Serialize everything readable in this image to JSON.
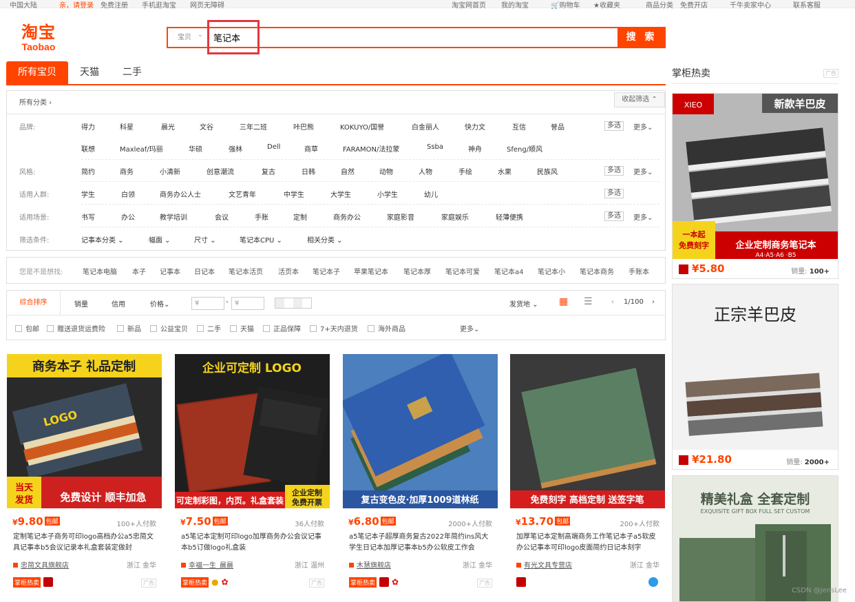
{
  "topbar": {
    "region": "中国大陆",
    "login": "亲，请登录",
    "register": "免费注册",
    "mobile": "手机逛淘宝",
    "access": "网页无障碍",
    "home": "淘宝网首页",
    "my": "我的淘宝",
    "cart": "购物车",
    "fav": "收藏夹",
    "category": "商品分类",
    "shop": "免费开店",
    "seller": "千牛卖家中心",
    "service": "联系客服"
  },
  "logo": {
    "cn": "淘宝",
    "en": "Taobao"
  },
  "search": {
    "scope": "宝贝",
    "value": "笔记本",
    "button": "搜 索"
  },
  "tabs": [
    "所有宝贝",
    "天猫",
    "二手"
  ],
  "filter": {
    "all": "所有分类 ›",
    "collapse": "收起筛选 ⌃",
    "multi": "多选",
    "more": "更多⌄",
    "brand_label": "品牌:",
    "brands1": [
      "得力",
      "科星",
      "晨光",
      "文谷",
      "三年二班",
      "咔巴熊",
      "KOKUYO/国誉",
      "白金丽人",
      "快力文",
      "互信",
      "誉品"
    ],
    "brands2": [
      "联想",
      "Maxleaf/玛丽",
      "华硕",
      "强林",
      "Dell",
      "商草",
      "FARAMON/法拉蒙",
      "Ssba",
      "神舟",
      "Sfeng/顺风"
    ],
    "style_label": "风格:",
    "styles": [
      "简约",
      "商务",
      "小清新",
      "创意潮流",
      "复古",
      "日韩",
      "自然",
      "动物",
      "人物",
      "手绘",
      "水果",
      "民族风"
    ],
    "people_label": "适用人群:",
    "people": [
      "学生",
      "白领",
      "商务办公人士",
      "文艺青年",
      "中学生",
      "大学生",
      "小学生",
      "幼儿"
    ],
    "scene_label": "适用场景:",
    "scenes": [
      "书写",
      "办公",
      "教学培训",
      "会议",
      "手账",
      "定制",
      "商务办公",
      "家庭影音",
      "家庭娱乐",
      "轻薄便携"
    ],
    "cond_label": "筛选条件:",
    "conds": [
      "记事本分类 ⌄",
      "幅面 ⌄",
      "尺寸 ⌄",
      "笔记本CPU ⌄",
      "相关分类 ⌄"
    ]
  },
  "guess": {
    "label": "您是不是想找:",
    "items": [
      "笔记本电脑",
      "本子",
      "记事本",
      "日记本",
      "笔记本活页",
      "活页本",
      "笔记本子",
      "苹果笔记本",
      "笔记本厚",
      "笔记本可爱",
      "笔记本a4",
      "笔记本小",
      "笔记本商务",
      "手账本"
    ]
  },
  "sort": {
    "items": [
      "综合排序",
      "销量",
      "信用",
      "价格⌄"
    ],
    "price_from": "¥",
    "price_to": "¥",
    "ship": "发货地 ⌄",
    "page": "1/100",
    "checks": [
      "包邮",
      "赠送退货运费险",
      "新品",
      "公益宝贝",
      "二手",
      "天猫",
      "正品保障",
      "7+天内退货",
      "海外商品"
    ],
    "more": "更多⌄"
  },
  "products": [
    {
      "price": "9.80",
      "tag": "包邮",
      "count": "100+人付款",
      "title": "定制笔记本子商务可印logo高档办公a5忠简文具记事本b5会议记录本礼盒套装定做封",
      "shop": "忠简文具旗舰店",
      "loc": "浙江 金华",
      "banner1": "商务本子 礼品定制",
      "banner2": "免费设计 顺丰加急"
    },
    {
      "price": "7.50",
      "tag": "包邮",
      "count": "36人付款",
      "title": "a5笔记本定制可印logo加厚商务办公会议记事本b5订做logo礼盒装",
      "shop": "幸福一生_晨晨",
      "loc": "浙江 温州",
      "banner1": "企业可定制 LOGO",
      "banner2": "可定制彩图，内页。礼盒套装"
    },
    {
      "price": "6.80",
      "tag": "包邮",
      "count": "2000+人付款",
      "title": "a5笔记本子超厚商务复古2022年简约ins风大学生日记本加厚记事本b5办公软皮工作会",
      "shop": "木慧旗舰店",
      "loc": "浙江 金华",
      "banner1": "",
      "banner2": "复古变色皮·加厚1009道林纸"
    },
    {
      "price": "13.70",
      "tag": "包邮",
      "count": "200+人付款",
      "title": "加厚笔记本定制高端商务工作笔记本子a5软皮办公记事本可印logo皮面简约日记本刻字",
      "shop": "有光文具专营店",
      "loc": "浙江 金华",
      "banner1": "",
      "banner2": "免费刻字 高档定制 送签字笔"
    }
  ],
  "side": {
    "title": "掌柜热卖",
    "ad": "广告",
    "items": [
      {
        "price": "¥5.80",
        "sales": "100+",
        "label": "销量:"
      },
      {
        "price": "¥21.80",
        "sales": "2000+",
        "label": "销量:"
      }
    ],
    "ad1_top": "新款羊巴皮",
    "ad1_bottom": "企业定制商务笔记本",
    "ad1_size": "A4·A5·A6 ·B5",
    "ad1_badge": "一本起 免费刻字",
    "ad2_top": "正宗羊巴皮",
    "ad3_top": "精美礼盒 全套定制",
    "ad3_sub": "EXQUISITE GIFT BOX FULL SET CUSTOM"
  },
  "labels": {
    "zg": "掌柜热卖",
    "ad": "广告",
    "watermark": "CSDN @JensLee"
  }
}
